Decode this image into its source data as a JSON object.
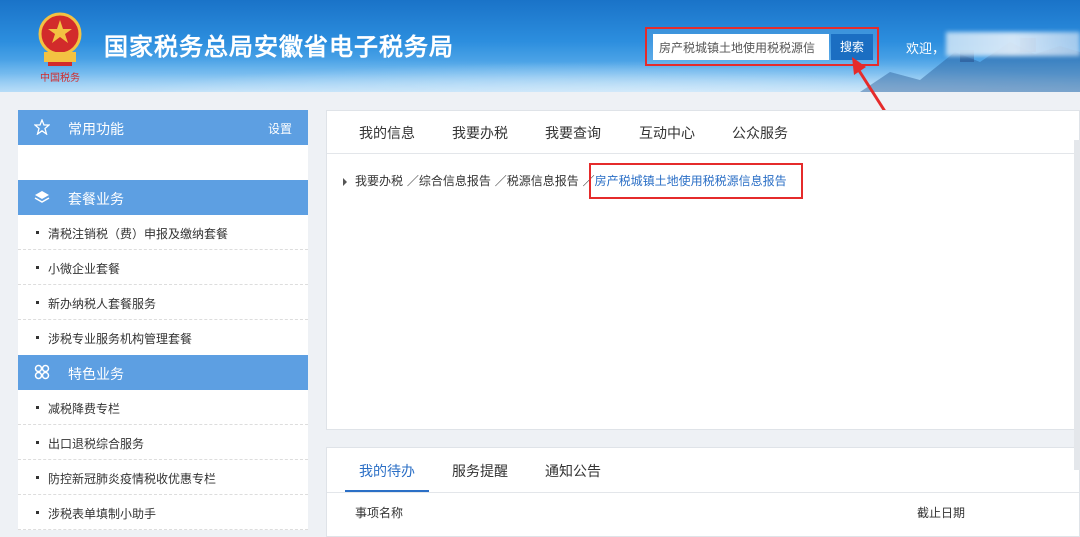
{
  "header": {
    "title": "国家税务总局安徽省电子税务局",
    "search_value": "房产税城镇土地使用税税源信",
    "search_button": "搜索",
    "welcome": "欢迎，",
    "emblem_icon": "tax-emblem-icon",
    "colors": {
      "accent_red": "#e52b2b",
      "header_blue": "#2c8ede"
    }
  },
  "sidebar": {
    "common": {
      "title": "常用功能",
      "settings": "设置"
    },
    "package": {
      "title": "套餐业务",
      "items": [
        "清税注销税（费）申报及缴纳套餐",
        "小微企业套餐",
        "新办纳税人套餐服务",
        "涉税专业服务机构管理套餐"
      ]
    },
    "special": {
      "title": "特色业务",
      "items": [
        "减税降费专栏",
        "出口退税综合服务",
        "防控新冠肺炎疫情税收优惠专栏",
        "涉税表单填制小助手"
      ]
    }
  },
  "main": {
    "tabs": [
      "我的信息",
      "我要办税",
      "我要查询",
      "互动中心",
      "公众服务"
    ],
    "breadcrumb": [
      "我要办税",
      "综合信息报告",
      "税源信息报告",
      "房产税城镇土地使用税税源信息报告"
    ],
    "separator": "／"
  },
  "bottom": {
    "tabs": [
      "我的待办",
      "服务提醒",
      "通知公告"
    ],
    "columns": [
      "事项名称",
      "截止日期"
    ]
  }
}
